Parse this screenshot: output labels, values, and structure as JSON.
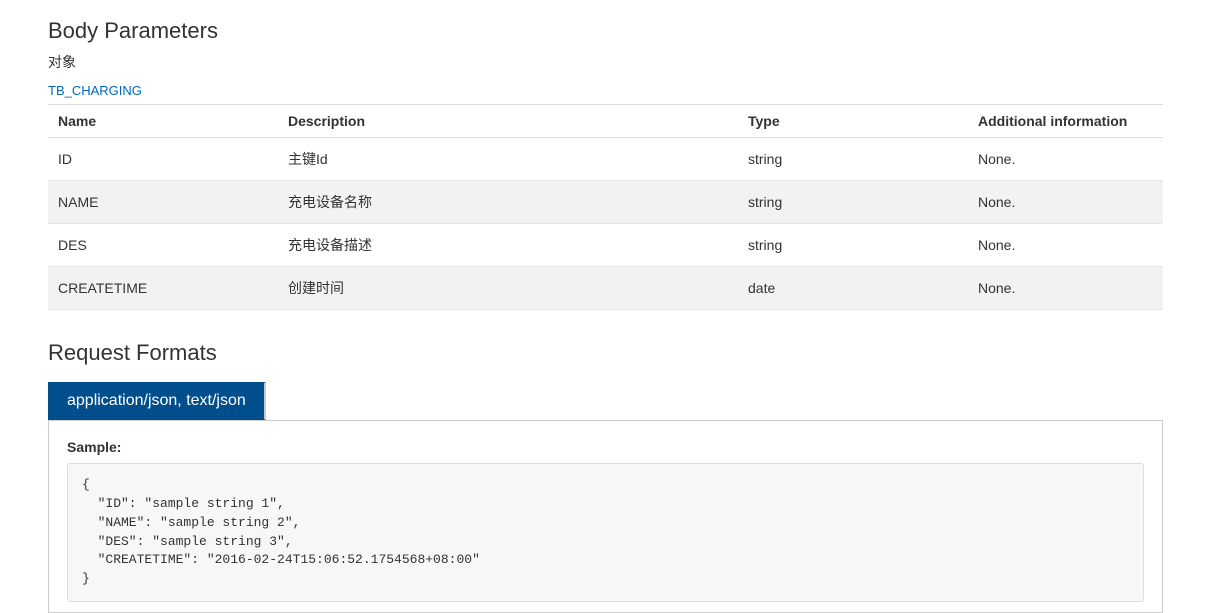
{
  "bodyParams": {
    "heading": "Body Parameters",
    "subheading": "对象",
    "typeLink": "TB_CHARGING",
    "columns": {
      "name": "Name",
      "description": "Description",
      "type": "Type",
      "additional": "Additional information"
    },
    "rows": [
      {
        "name": "ID",
        "description": "主键Id",
        "type": "string",
        "additional": "None."
      },
      {
        "name": "NAME",
        "description": "充电设备名称",
        "type": "string",
        "additional": "None."
      },
      {
        "name": "DES",
        "description": "充电设备描述",
        "type": "string",
        "additional": "None."
      },
      {
        "name": "CREATETIME",
        "description": "创建时间",
        "type": "date",
        "additional": "None."
      }
    ]
  },
  "requestFormats": {
    "heading": "Request Formats",
    "tabs": [
      {
        "label": "application/json, text/json"
      }
    ],
    "sampleLabel": "Sample:",
    "sampleCode": "{\n  \"ID\": \"sample string 1\",\n  \"NAME\": \"sample string 2\",\n  \"DES\": \"sample string 3\",\n  \"CREATETIME\": \"2016-02-24T15:06:52.1754568+08:00\"\n}"
  }
}
